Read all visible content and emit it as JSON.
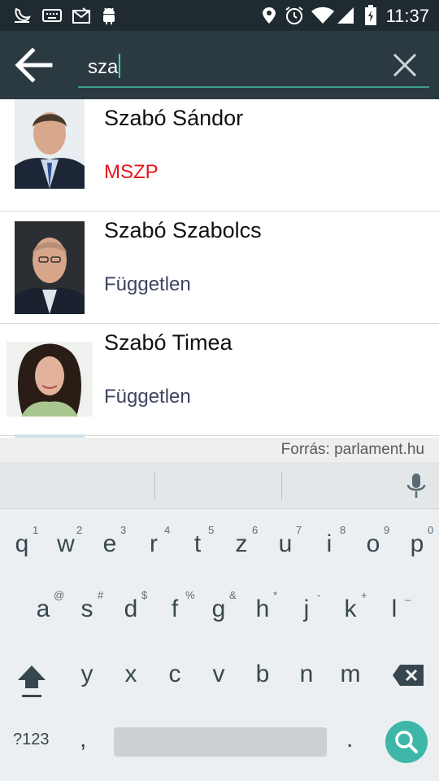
{
  "status_bar": {
    "time": "11:37",
    "icons": [
      "moon-sleep-icon",
      "keyboard-icon",
      "mail-photo-icon",
      "android-icon",
      "location-icon",
      "alarm-icon",
      "wifi-icon",
      "signal-icon",
      "battery-icon"
    ]
  },
  "toolbar": {
    "search_value": "sza",
    "back_icon": "arrow-back-icon",
    "clear_icon": "close-icon"
  },
  "results": [
    {
      "name": "Szabó Sándor",
      "party": "MSZP",
      "party_color": "#e5161a"
    },
    {
      "name": "Szabó Szabolcs",
      "party": "Független",
      "party_color": "#3d4560"
    },
    {
      "name": "Szabó Timea",
      "party": "Független",
      "party_color": "#3d4560"
    }
  ],
  "source": "Forrás: parlament.hu",
  "keyboard": {
    "row1": [
      {
        "key": "q",
        "sup": "1"
      },
      {
        "key": "w",
        "sup": "2"
      },
      {
        "key": "e",
        "sup": "3"
      },
      {
        "key": "r",
        "sup": "4"
      },
      {
        "key": "t",
        "sup": "5"
      },
      {
        "key": "z",
        "sup": "6"
      },
      {
        "key": "u",
        "sup": "7"
      },
      {
        "key": "i",
        "sup": "8"
      },
      {
        "key": "o",
        "sup": "9"
      },
      {
        "key": "p",
        "sup": "0"
      }
    ],
    "row2": [
      {
        "key": "a",
        "sup": "@"
      },
      {
        "key": "s",
        "sup": "#"
      },
      {
        "key": "d",
        "sup": "$"
      },
      {
        "key": "f",
        "sup": "%"
      },
      {
        "key": "g",
        "sup": "&"
      },
      {
        "key": "h",
        "sup": "*"
      },
      {
        "key": "j",
        "sup": "-"
      },
      {
        "key": "k",
        "sup": "+"
      },
      {
        "key": "l",
        "sup": "_"
      }
    ],
    "row3": [
      {
        "key": "y",
        "sup": ""
      },
      {
        "key": "x",
        "sup": ""
      },
      {
        "key": "c",
        "sup": ""
      },
      {
        "key": "v",
        "sup": ""
      },
      {
        "key": "b",
        "sup": ""
      },
      {
        "key": "n",
        "sup": ""
      },
      {
        "key": "m",
        "sup": ""
      }
    ],
    "symbols_label": "?123",
    "comma": ",",
    "period": ".",
    "accent_color": "#3eb7a8"
  }
}
